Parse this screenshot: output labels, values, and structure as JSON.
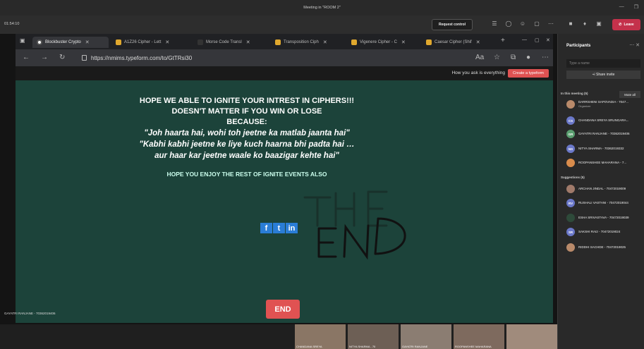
{
  "window": {
    "title": "Meeting in \"ROOM 2\""
  },
  "toolbar": {
    "timer": "01:54:10",
    "request_control": "Request control",
    "leave": "Leave"
  },
  "browser": {
    "tabs": [
      {
        "label": "Blockbuster Crypto"
      },
      {
        "label": "A1Z26 Cipher - Lett"
      },
      {
        "label": "Morse Code Transl"
      },
      {
        "label": "Transposition Ciph"
      },
      {
        "label": "Vigenere Cipher - C"
      },
      {
        "label": "Caesar Cipher (Shif"
      }
    ],
    "url": "https://nmims.typeform.com/to/GtTRsi30"
  },
  "page": {
    "tagline": "How you ask is everything",
    "create_btn": "Create a typeform",
    "lines_bold": [
      "HOPE WE ABLE TO IGNITE YOUR INTREST IN CIPHERS!!!",
      "DOESN'T MATTER IF YOU WIN OR LOSE",
      "BECAUSE:"
    ],
    "lines_italic": [
      "\"Joh haarta hai, wohi toh jeetne ka matlab jaanta hai\"",
      "\"Kabhi kabhi jeetne ke liye kuch haarna bhi padta hai … aur haar kar jeetne waale ko baazigar kehte hai\""
    ],
    "sub": "HOPE YOU ENJOY THE REST OF IGNITE EVENTS ALSO",
    "social": [
      "f",
      "t",
      "in"
    ],
    "end_btn": "END"
  },
  "caption": "GAYATRI RANJANE - 70362019406",
  "thumbs": [
    {
      "label": "CHANDANA SREYA"
    },
    {
      "label": "NITYA SHARMA - 70"
    },
    {
      "label": "GAYATRI RANJANE"
    },
    {
      "label": "ROOPANSHEE MAHARANA"
    },
    {
      "label": ""
    }
  ],
  "sidebar": {
    "title": "Participants",
    "search_placeholder": "Type a name",
    "share_invite": "Share invite",
    "in_meeting": "In this meeting (5)",
    "mute_all": "Mute all",
    "suggestions": "Suggestions (5)",
    "in_meeting_people": [
      {
        "initials": "",
        "name": "DARRSHENI SAPOVADIA - 7047...",
        "role": "Organizer",
        "color": "#b98a6a"
      },
      {
        "initials": "CS",
        "name": "CHANDANA SREYA SRUNGARA...",
        "role": "",
        "color": "#6b78c9"
      },
      {
        "initials": "GR",
        "name": "GAYATRI RANJANE - 70362019406",
        "role": "",
        "color": "#5a9e6f"
      },
      {
        "initials": "NS",
        "name": "NITYA SHARMA - 70362019332",
        "role": "",
        "color": "#6b78c9"
      },
      {
        "initials": "",
        "name": "ROOPANSHEE MAHARANA - 7...",
        "role": "",
        "color": "#d98c4c"
      }
    ],
    "suggested_people": [
      {
        "initials": "",
        "name": "ARCHAN JINDAL - 70472019009",
        "color": "#a07a6a"
      },
      {
        "initials": "RV",
        "name": "RUSHALI VASTANI - 70472019044",
        "color": "#6b78c9"
      },
      {
        "initials": "",
        "name": "ESHA SRIVASTAVA - 70472019039",
        "color": "#2e4a3a"
      },
      {
        "initials": "SR",
        "name": "SAKSHI RAI2 - 70472019024",
        "color": "#6b78c9"
      },
      {
        "initials": "",
        "name": "RIDDHI SACHDE - 70472019025",
        "color": "#b98a6a"
      }
    ]
  }
}
